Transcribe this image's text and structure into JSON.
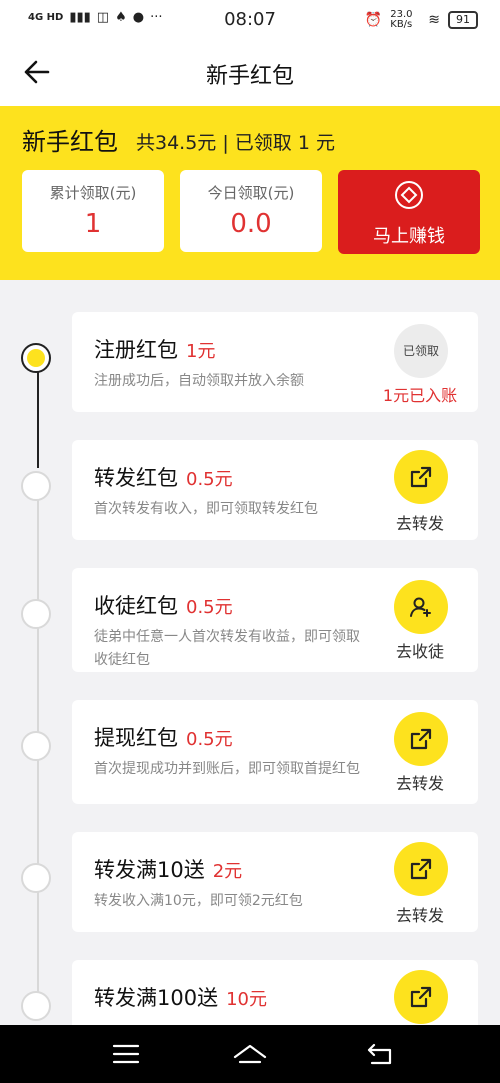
{
  "status": {
    "network": "4G HD",
    "time": "08:07",
    "speed": "23.0 KB/s",
    "battery": "91"
  },
  "nav": {
    "title": "新手红包"
  },
  "hero": {
    "title": "新手红包",
    "summary": "共34.5元 | 已领取 1 元",
    "cards": [
      {
        "label": "累计领取(元)",
        "value": "1"
      },
      {
        "label": "今日领取(元)",
        "value": "0.0"
      }
    ],
    "earn_label": "马上赚钱"
  },
  "items": [
    {
      "title": "注册红包",
      "amount": "1元",
      "desc": "注册成功后，自动领取并放入余额",
      "action_icon": "claimed",
      "action_text": "已领取",
      "action_label": "1元已入账"
    },
    {
      "title": "转发红包",
      "amount": "0.5元",
      "desc": "首次转发有收入，即可领取转发红包",
      "action_icon": "share-icon",
      "action_label": "去转发"
    },
    {
      "title": "收徒红包",
      "amount": "0.5元",
      "desc": "徒弟中任意一人首次转发有收益，即可领取收徒红包",
      "action_icon": "add-user-icon",
      "action_label": "去收徒"
    },
    {
      "title": "提现红包",
      "amount": "0.5元",
      "desc": "首次提现成功并到账后，即可领取首提红包",
      "action_icon": "share-icon",
      "action_label": "去转发"
    },
    {
      "title": "转发满10送",
      "amount": "2元",
      "desc": "转发收入满10元，即可领2元红包",
      "action_icon": "share-icon",
      "action_label": "去转发"
    },
    {
      "title": "转发满100送",
      "amount": "10元",
      "desc": "",
      "action_icon": "share-icon",
      "action_label": ""
    }
  ]
}
